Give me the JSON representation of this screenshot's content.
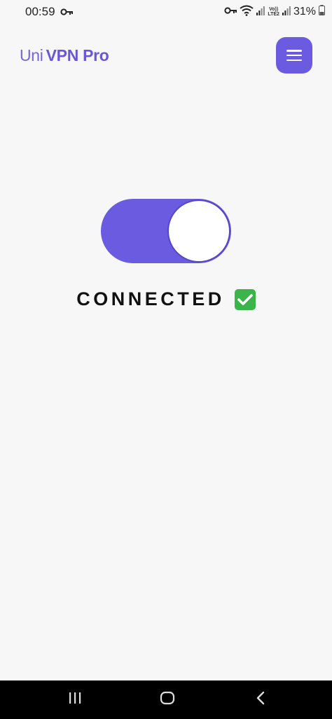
{
  "status_bar": {
    "time": "00:59",
    "network_label_top": "Vo))",
    "network_label_bottom": "LTE2",
    "battery_percent": "31%",
    "icons": [
      "vpn-key-icon",
      "wifi-icon",
      "signal-icon",
      "battery-icon"
    ]
  },
  "header": {
    "brand_prefix": "Uni",
    "brand_name": "VPN Pro",
    "menu_icon": "hamburger-menu-icon"
  },
  "main": {
    "toggle_state": "on",
    "status_text": "CONNECTED",
    "status_icon": "check-mark-icon"
  },
  "nav_bar": {
    "buttons": [
      "recent-apps-icon",
      "home-icon",
      "back-icon"
    ]
  },
  "colors": {
    "accent": "#6b5be0",
    "background": "#f7f7f7",
    "check_green": "#3bb54a"
  }
}
